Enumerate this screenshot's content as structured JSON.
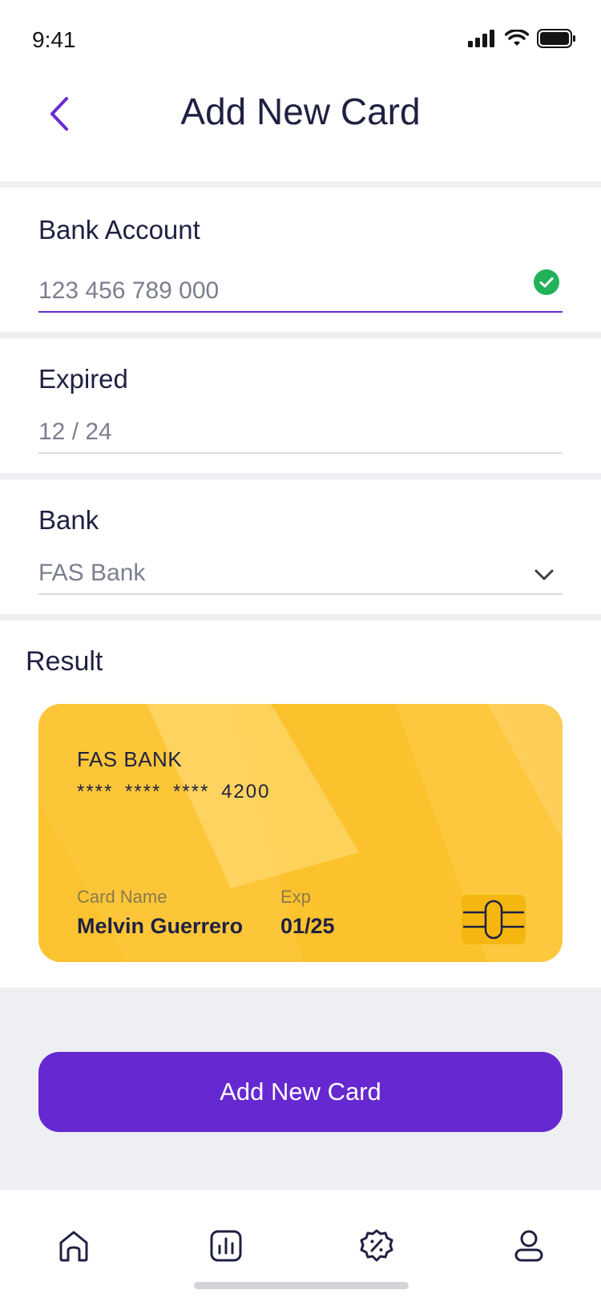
{
  "status_bar": {
    "time": "9:41"
  },
  "header": {
    "title": "Add New Card"
  },
  "form": {
    "bank_account": {
      "label": "Bank Account",
      "value": "123 456 789 000"
    },
    "expired": {
      "label": "Expired",
      "value": "12 / 24"
    },
    "bank": {
      "label": "Bank",
      "value": "FAS Bank"
    }
  },
  "result": {
    "label": "Result",
    "card": {
      "bank_name": "FAS BANK",
      "number": "**** **** **** 4200",
      "name_label": "Card Name",
      "name": "Melvin Guerrero",
      "exp_label": "Exp",
      "exp": "01/25"
    }
  },
  "cta": {
    "label": "Add New Card"
  },
  "tabs": [
    "home-icon",
    "chart-icon",
    "discount-icon",
    "profile-icon"
  ],
  "colors": {
    "accent": "#6628d1",
    "card": "#fcc22d",
    "success": "#21b15a",
    "text": "#1f2142"
  }
}
